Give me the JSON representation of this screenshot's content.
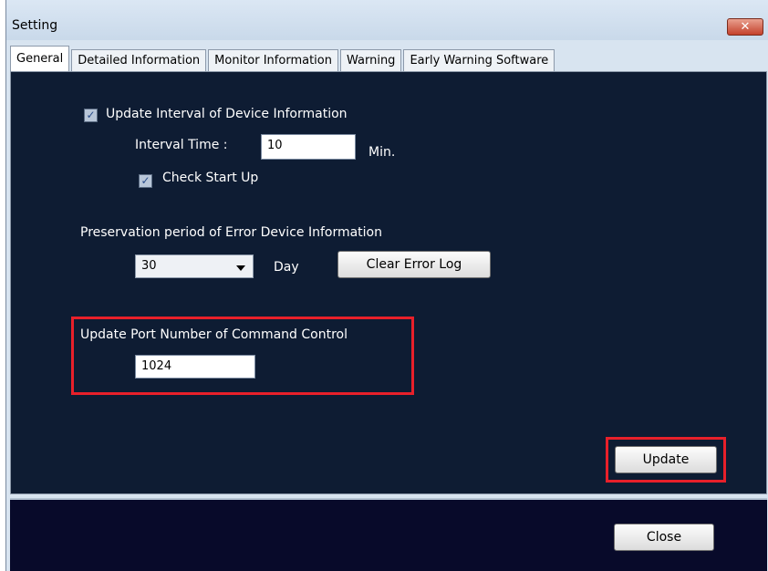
{
  "window": {
    "title": "Setting",
    "close_glyph": "✕"
  },
  "tabs": [
    {
      "label": "General",
      "active": true
    },
    {
      "label": "Detailed Information",
      "active": false
    },
    {
      "label": "Monitor Information",
      "active": false
    },
    {
      "label": "Warning",
      "active": false
    },
    {
      "label": "Early Warning Software",
      "active": false
    }
  ],
  "general": {
    "update_interval": {
      "label": "Update Interval of Device Information",
      "checked": true
    },
    "interval_time": {
      "label": "Interval Time :",
      "value": "10",
      "unit": "Min."
    },
    "check_start_up": {
      "label": "Check Start Up",
      "checked": true
    },
    "preservation": {
      "label": "Preservation period of  Error Device Information",
      "selected": "30",
      "unit": "Day",
      "clear_button": "Clear Error Log"
    },
    "port": {
      "label": "Update Port Number of Command Control",
      "value": "1024"
    },
    "update_button": "Update"
  },
  "footer": {
    "close_button": "Close"
  },
  "colors": {
    "panel_bg": "#0e1c33",
    "footer_bg": "#080a2a",
    "highlight": "#e8202a",
    "titlebar": "#d8e4f0"
  }
}
